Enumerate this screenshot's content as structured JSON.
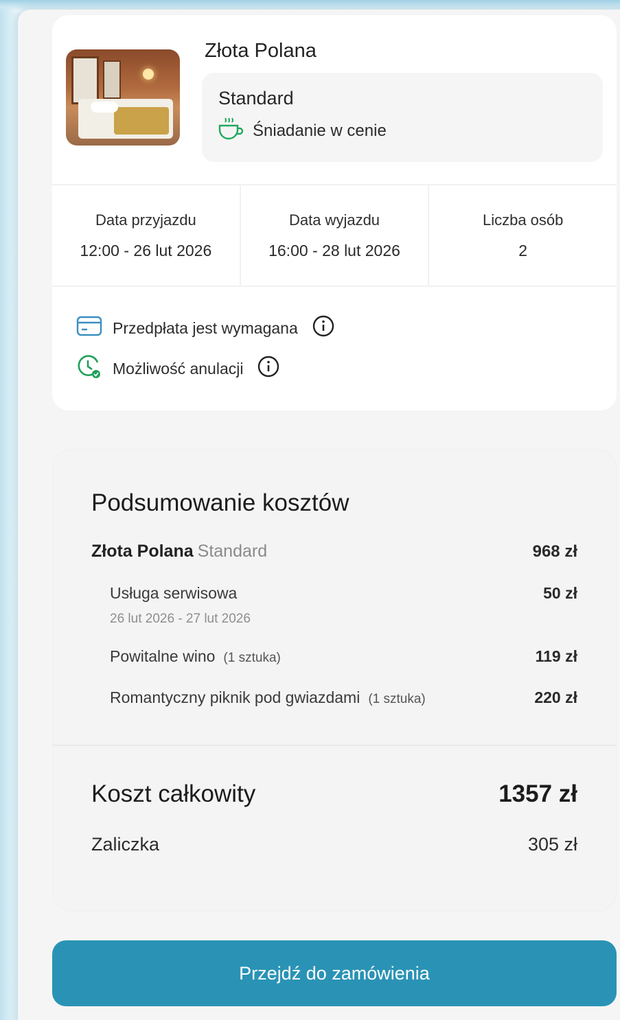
{
  "booking": {
    "hotel_name": "Złota Polana",
    "room_type": "Standard",
    "meal_plan": "Śniadanie w cenie",
    "checkin_label": "Data przyjazdu",
    "checkin_value": "12:00 - 26 lut 2026",
    "checkout_label": "Data wyjazdu",
    "checkout_value": "16:00 - 28 lut 2026",
    "guests_label": "Liczba osób",
    "guests_value": "2",
    "prepayment_text": "Przedpłata jest wymagana",
    "cancellation_text": "Możliwość anulacji",
    "colors": {
      "card_icon": "#3a8fc0",
      "cancel_icon": "#1fa15a",
      "meal_icon": "#22a85a"
    },
    "icons": [
      "hotel-room-photo",
      "coffee-cup-icon",
      "credit-card-icon",
      "clock-check-icon",
      "info-icon"
    ]
  },
  "summary": {
    "title": "Podsumowanie kosztów",
    "main_item": {
      "name": "Złota Polana",
      "room": "Standard",
      "amount": "968 zł"
    },
    "extras": [
      {
        "name": "Usługa serwisowa",
        "dates": "26 lut 2026 - 27 lut 2026",
        "amount": "50 zł"
      },
      {
        "name": "Powitalne wino",
        "qty": "(1 sztuka)",
        "amount": "119 zł"
      },
      {
        "name": "Romantyczny piknik pod gwiazdami",
        "qty": "(1 sztuka)",
        "amount": "220 zł"
      }
    ],
    "total_label": "Koszt całkowity",
    "total_amount": "1357 zł",
    "deposit_label": "Zaliczka",
    "deposit_amount": "305 zł"
  },
  "cta": {
    "label": "Przejdź do zamówienia",
    "color": "#2a93b5"
  }
}
